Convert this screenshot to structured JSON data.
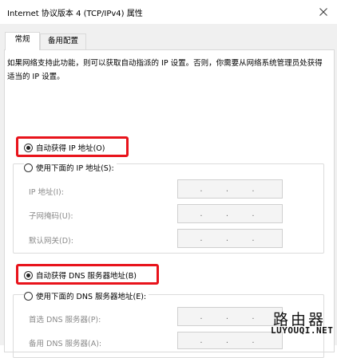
{
  "window": {
    "title": "Internet 协议版本 4 (TCP/IPv4) 属性"
  },
  "tabs": [
    {
      "label": "常规",
      "active": true
    },
    {
      "label": "备用配置",
      "active": false
    }
  ],
  "description": "如果网络支持此功能，则可以获取自动指派的 IP 设置。否则，你需要从网络系统管理员处获得适当的 IP 设置。",
  "ip_section": {
    "auto_option": "自动获得 IP 地址(O)",
    "manual_option": "使用下面的 IP 地址(S):",
    "fields": [
      {
        "label": "IP 地址(I):"
      },
      {
        "label": "子网掩码(U):"
      },
      {
        "label": "默认网关(D):"
      }
    ]
  },
  "dns_section": {
    "auto_option": "自动获得 DNS 服务器地址(B)",
    "manual_option": "使用下面的 DNS 服务器地址(E):",
    "fields": [
      {
        "label": "首选 DNS 服务器(P):"
      },
      {
        "label": "备用 DNS 服务器(A):"
      }
    ]
  },
  "ip_separator": ".",
  "watermark": {
    "text_cn": "路由器",
    "text_en": "LUYOUQI.NET"
  },
  "colors": {
    "highlight": "#e8131b",
    "disabled_text": "#8a8a8a",
    "dialog_bg": "#f0f0f0"
  },
  "icons": {
    "close": "close-icon"
  }
}
